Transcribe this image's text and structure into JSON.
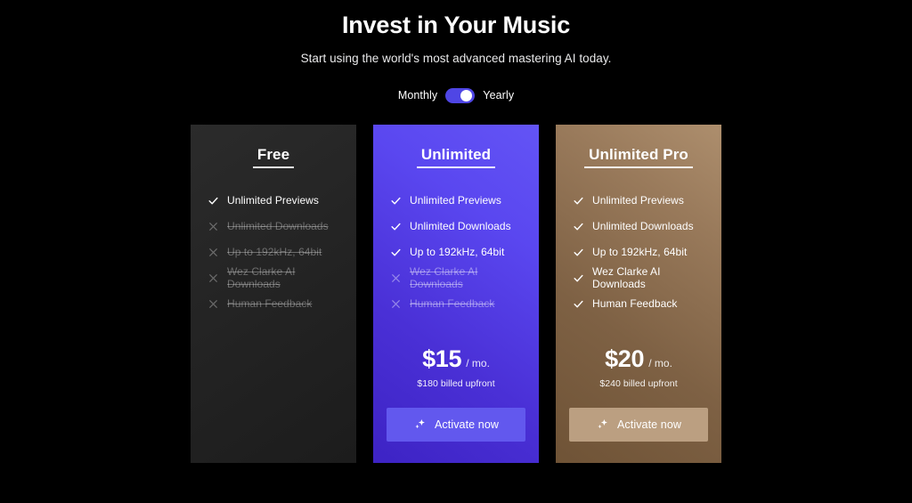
{
  "header": {
    "title": "Invest in Your Music",
    "subtitle": "Start using the world's most advanced mastering AI today."
  },
  "billing": {
    "monthly_label": "Monthly",
    "yearly_label": "Yearly",
    "selected": "Yearly",
    "toggle_color": "#4f46e5"
  },
  "plans": [
    {
      "name": "Free",
      "accent": "#242424",
      "has_price": false,
      "features": [
        {
          "label": "Unlimited Previews",
          "included": true
        },
        {
          "label": "Unlimited Downloads",
          "included": false
        },
        {
          "label": "Up to 192kHz, 64bit",
          "included": false
        },
        {
          "label": "Wez Clarke AI Downloads",
          "included": false
        },
        {
          "label": "Human Feedback",
          "included": false
        }
      ]
    },
    {
      "name": "Unlimited",
      "accent": "#5a47f0",
      "has_price": true,
      "price_amount": "$15",
      "price_period": "/ mo.",
      "price_note": "$180 billed upfront",
      "cta_label": "Activate now",
      "features": [
        {
          "label": "Unlimited Previews",
          "included": true
        },
        {
          "label": "Unlimited Downloads",
          "included": true
        },
        {
          "label": "Up to 192kHz, 64bit",
          "included": true
        },
        {
          "label": "Wez Clarke AI Downloads",
          "included": false
        },
        {
          "label": "Human Feedback",
          "included": false
        }
      ]
    },
    {
      "name": "Unlimited Pro",
      "accent": "#997a5b",
      "has_price": true,
      "price_amount": "$20",
      "price_period": "/ mo.",
      "price_note": "$240 billed upfront",
      "cta_label": "Activate now",
      "features": [
        {
          "label": "Unlimited Previews",
          "included": true
        },
        {
          "label": "Unlimited Downloads",
          "included": true
        },
        {
          "label": "Up to 192kHz, 64bit",
          "included": true
        },
        {
          "label": "Wez Clarke AI Downloads",
          "included": true
        },
        {
          "label": "Human Feedback",
          "included": true
        }
      ]
    }
  ]
}
